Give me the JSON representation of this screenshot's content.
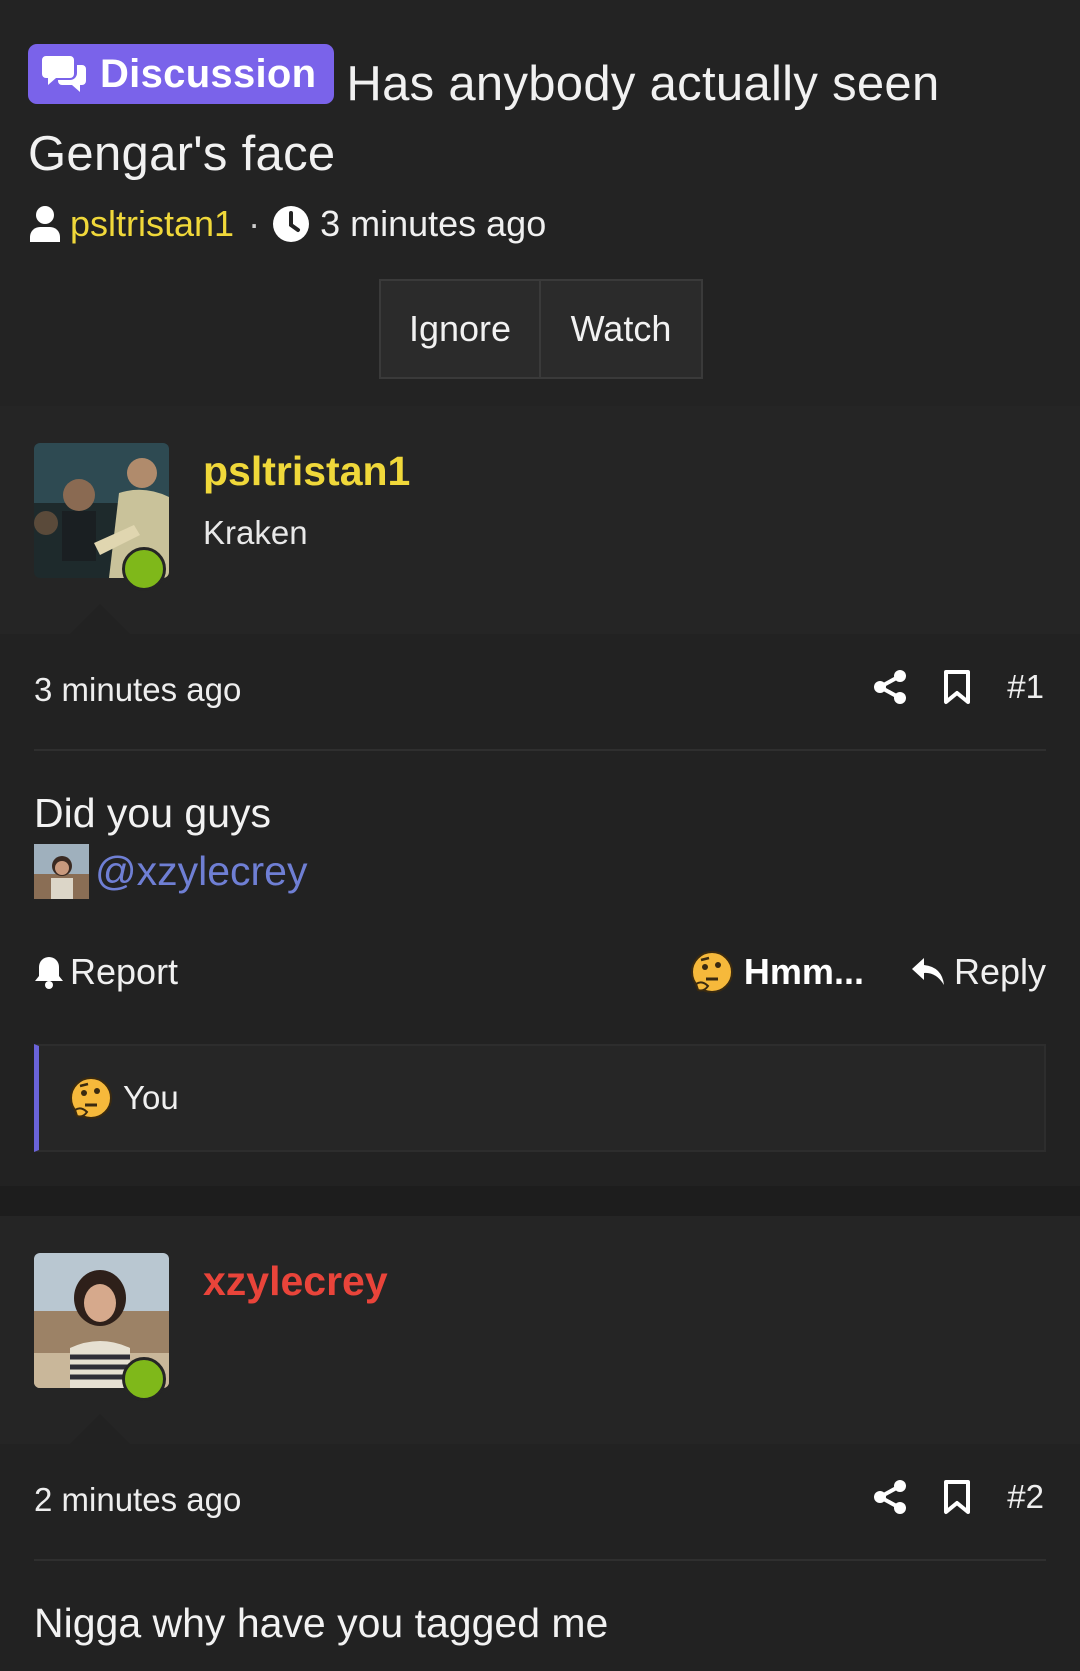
{
  "thread": {
    "prefix": "Discussion",
    "title": "Has anybody actually seen Gengar's face",
    "author": "psltristan1",
    "separator": "·",
    "time": "3 minutes ago",
    "ignore_label": "Ignore",
    "watch_label": "Watch"
  },
  "posts": [
    {
      "username": "psltristan1",
      "username_color": "#f0d83a",
      "user_title": "Kraken",
      "time": "3 minutes ago",
      "number": "#1",
      "message": "Did you guys",
      "mention": "@xzylecrey",
      "report_label": "Report",
      "reaction_label": "Hmm...",
      "reply_label": "Reply",
      "reactions_summary": "You"
    },
    {
      "username": "xzylecrey",
      "username_color": "#e9443a",
      "time": "2 minutes ago",
      "number": "#2",
      "message": "Nigga why have you tagged me"
    }
  ],
  "colors": {
    "accent": "#7a63ea",
    "online": "#7fb81a",
    "mention": "#6f7fd4"
  }
}
